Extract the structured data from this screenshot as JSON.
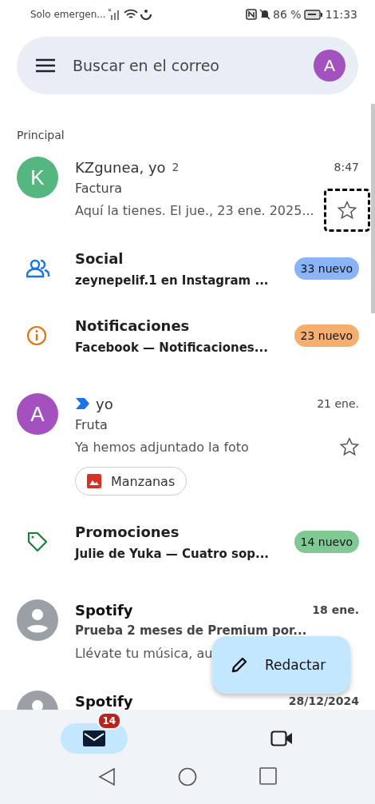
{
  "status_bar": {
    "carrier": "Solo emergen...",
    "battery": "86 %",
    "time": "11:33"
  },
  "search": {
    "placeholder": "Buscar en el correo",
    "avatar": "A"
  },
  "section": "Principal",
  "items": [
    {
      "kind": "mail",
      "avatar": "K",
      "color": "#53b77f",
      "sender": "KZgunea, yo",
      "count": "2",
      "time": "8:47",
      "subject": "Factura",
      "snippet": "Aquí la tienes. El jue., 23 ene. 2025...",
      "unread": false,
      "starred": false,
      "focused": true
    },
    {
      "kind": "social",
      "title": "Social",
      "snippet": "zeynepelif.1 en Instagram ...",
      "badge": "33 nuevo",
      "color": "#8ab4f8"
    },
    {
      "kind": "updates",
      "title": "Notificaciones",
      "snippet": "Facebook — Notificaciones...",
      "badge": "23 nuevo",
      "color": "#f6ae6e"
    },
    {
      "kind": "mail",
      "avatar": "A",
      "color": "#a251bf",
      "sender": "yo",
      "time": "21 ene.",
      "subject": "Fruta",
      "snippet": "Ya hemos adjuntado la foto",
      "unread": false,
      "important": true,
      "starred": false,
      "attachment": "Manzanas"
    },
    {
      "kind": "promotions",
      "title": "Promociones",
      "snippet": "Julie de Yuka — Cuatro sop...",
      "badge": "14 nuevo",
      "color": "#80c995"
    },
    {
      "kind": "mail",
      "color": "#9aa0a6",
      "sender": "Spotify",
      "time": "18 ene.",
      "subject": "Prueba 2 meses de Premium por...",
      "snippet": "Llévate tu música, au",
      "unread": true
    },
    {
      "kind": "mail",
      "color": "#9aa0a6",
      "sender": "Spotify",
      "time": "28/12/2024",
      "unread": true
    }
  ],
  "compose": "Redactar",
  "nav": [
    {
      "kind": "mail",
      "badge": "14",
      "selected": true
    },
    {
      "kind": "video",
      "selected": false
    }
  ]
}
